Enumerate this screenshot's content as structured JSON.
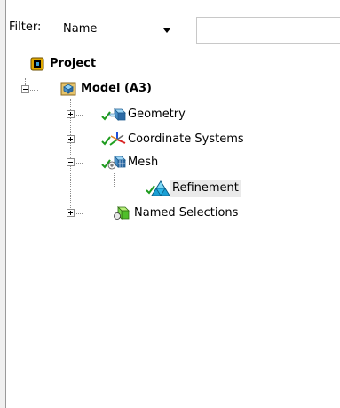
{
  "filter": {
    "label": "Filter:",
    "selected": "Name",
    "search_value": ""
  },
  "tree": {
    "project": {
      "label": "Project",
      "icon": "project-icon"
    },
    "model": {
      "label": "Model (A3)",
      "icon": "model-icon"
    },
    "children": [
      {
        "label": "Geometry",
        "icon": "geometry-icon",
        "status": "ok"
      },
      {
        "label": "Coordinate Systems",
        "icon": "coordinate-systems-icon",
        "status": "ok"
      },
      {
        "label": "Mesh",
        "icon": "mesh-icon",
        "status": "ok"
      },
      {
        "label": "Refinement",
        "icon": "refinement-icon",
        "status": "ok"
      },
      {
        "label": "Named Selections",
        "icon": "named-selections-icon"
      }
    ]
  },
  "colors": {
    "check": "#1e9b1e",
    "selection": "#eaeaea"
  }
}
